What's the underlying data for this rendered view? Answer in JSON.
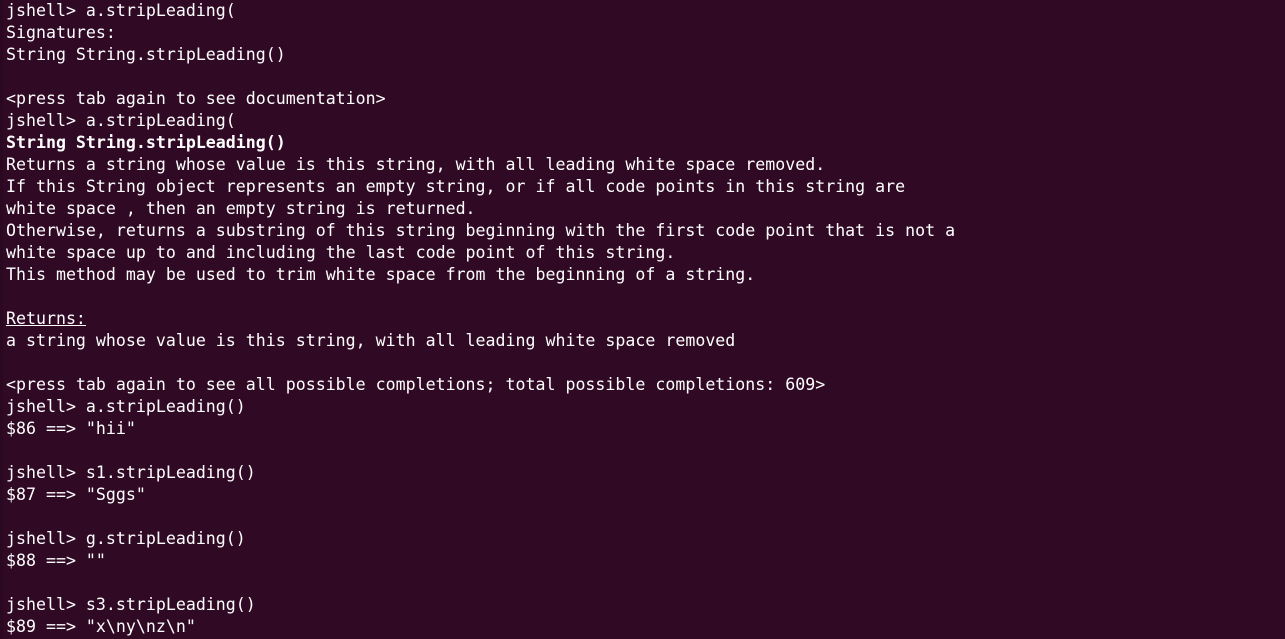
{
  "terminal": {
    "colors": {
      "background": "#300a24",
      "foreground": "#ffffff"
    },
    "lines": [
      {
        "text": "jshell> a.stripLeading(",
        "style": "normal"
      },
      {
        "text": "Signatures:",
        "style": "normal"
      },
      {
        "text": "String String.stripLeading()",
        "style": "normal"
      },
      {
        "text": "",
        "style": "normal"
      },
      {
        "text": "<press tab again to see documentation>",
        "style": "normal"
      },
      {
        "text": "jshell> a.stripLeading(",
        "style": "normal"
      },
      {
        "text": "String String.stripLeading()",
        "style": "bold"
      },
      {
        "text": "Returns a string whose value is this string, with all leading white space removed.",
        "style": "normal"
      },
      {
        "text": "If this String object represents an empty string, or if all code points in this string are",
        "style": "normal"
      },
      {
        "text": "white space , then an empty string is returned.",
        "style": "normal"
      },
      {
        "text": "Otherwise, returns a substring of this string beginning with the first code point that is not a",
        "style": "normal"
      },
      {
        "text": "white space up to and including the last code point of this string.",
        "style": "normal"
      },
      {
        "text": "This method may be used to trim white space from the beginning of a string.",
        "style": "normal"
      },
      {
        "text": "",
        "style": "normal"
      },
      {
        "text": "Returns:",
        "style": "underline"
      },
      {
        "text": "a string whose value is this string, with all leading white space removed",
        "style": "normal"
      },
      {
        "text": "",
        "style": "normal"
      },
      {
        "text": "<press tab again to see all possible completions; total possible completions: 609>",
        "style": "normal"
      },
      {
        "text": "jshell> a.stripLeading()",
        "style": "normal"
      },
      {
        "text": "$86 ==> \"hii\"",
        "style": "normal"
      },
      {
        "text": "",
        "style": "normal"
      },
      {
        "text": "jshell> s1.stripLeading()",
        "style": "normal"
      },
      {
        "text": "$87 ==> \"Sggs\"",
        "style": "normal"
      },
      {
        "text": "",
        "style": "normal"
      },
      {
        "text": "jshell> g.stripLeading()",
        "style": "normal"
      },
      {
        "text": "$88 ==> \"\"",
        "style": "normal"
      },
      {
        "text": "",
        "style": "normal"
      },
      {
        "text": "jshell> s3.stripLeading()",
        "style": "normal"
      },
      {
        "text": "$89 ==> \"x\\ny\\nz\\n\"",
        "style": "normal"
      }
    ]
  }
}
